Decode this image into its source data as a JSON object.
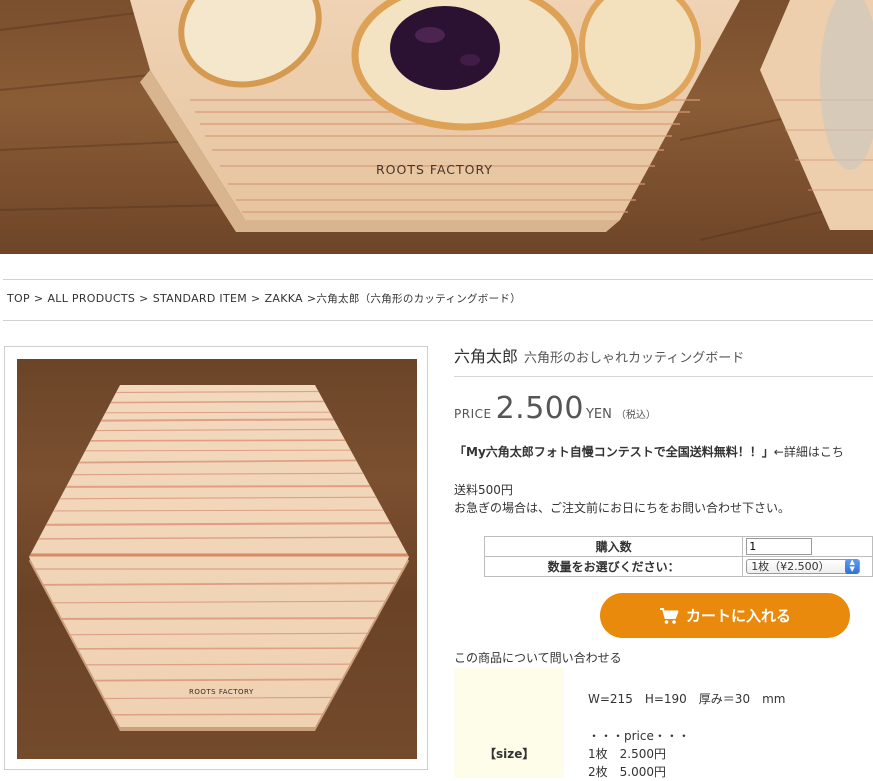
{
  "hero": {
    "board_brand": "ROOTS FACTORY"
  },
  "breadcrumb": {
    "items": [
      "TOP",
      "ALL PRODUCTS",
      "STANDARD ITEM",
      "ZAKKA"
    ],
    "separator": ">",
    "current": "六角太郎（六角形のカッティングボード）"
  },
  "product": {
    "image_brand": "ROOTS FACTORY",
    "name": "六角太郎",
    "subtitle": "六角形のおしゃれカッティングボード",
    "price_label": "PRICE",
    "price": "2.500",
    "currency": "YEN",
    "tax_note": "（税込）",
    "notice_bold": "「My六角太郎フォト自慢コンテストで全国送料無料！！」",
    "notice_rest": "←詳細はこち",
    "shipping_line1": "送料500円",
    "shipping_line2": "お急ぎの場合は、ご注文前にお日にちをお問い合わせ下さい。"
  },
  "order_form": {
    "qty_label": "購入数",
    "qty_value": "1",
    "select_label": "数量をお選びください：",
    "select_value": "1枚（¥2.500）",
    "cart_button": "カートに入れる",
    "inquiry_link": "この商品について問い合わせる"
  },
  "spec": {
    "label": "【size】",
    "size_line": "W=215　H=190　厚み＝30　mm",
    "price_heading": "・・・price・・・",
    "price_rows": [
      "1枚　2.500円",
      "2枚　5.000円"
    ]
  },
  "colors": {
    "accent": "#e98a0c",
    "spec_bg": "#fdfde9",
    "rule": "#d0d0d0"
  }
}
